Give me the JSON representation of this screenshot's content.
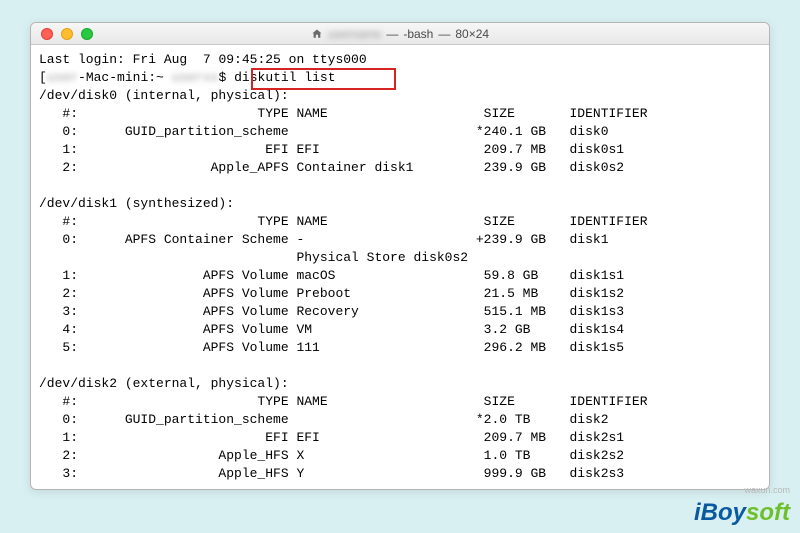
{
  "window": {
    "title_sep": "—",
    "title_shell": "-bash",
    "title_dims": "80×24"
  },
  "term": {
    "last_login_prefix": "Last login: ",
    "last_login": "Fri Aug  7 09:45:25 on ttys000",
    "prompt_host_suffix": "-Mac-mini:~",
    "prompt_dollar": "$",
    "command": "diskutil list",
    "disk0_header": "/dev/disk0 (internal, physical):",
    "cols": "   #:                       TYPE NAME                    SIZE       IDENTIFIER",
    "d0": [
      "   0:      GUID_partition_scheme                        *240.1 GB   disk0",
      "   1:                        EFI EFI                     209.7 MB   disk0s1",
      "   2:                 Apple_APFS Container disk1         239.9 GB   disk0s2"
    ],
    "disk1_header": "/dev/disk1 (synthesized):",
    "d1": [
      "   0:      APFS Container Scheme -                      +239.9 GB   disk1",
      "                                 Physical Store disk0s2",
      "   1:                APFS Volume macOS                   59.8 GB    disk1s1",
      "   2:                APFS Volume Preboot                 21.5 MB    disk1s2",
      "   3:                APFS Volume Recovery                515.1 MB   disk1s3",
      "   4:                APFS Volume VM                      3.2 GB     disk1s4",
      "   5:                APFS Volume 111                     296.2 MB   disk1s5"
    ],
    "disk2_header": "/dev/disk2 (external, physical):",
    "d2": [
      "   0:      GUID_partition_scheme                        *2.0 TB     disk2",
      "   1:                        EFI EFI                     209.7 MB   disk2s1",
      "   2:                  Apple_HFS X                       1.0 TB     disk2s2",
      "   3:                  Apple_HFS Y                       999.9 GB   disk2s3"
    ]
  },
  "watermark": {
    "i": "i",
    "boy": "Boy",
    "soft": "soft",
    "small": "waxun.com"
  }
}
